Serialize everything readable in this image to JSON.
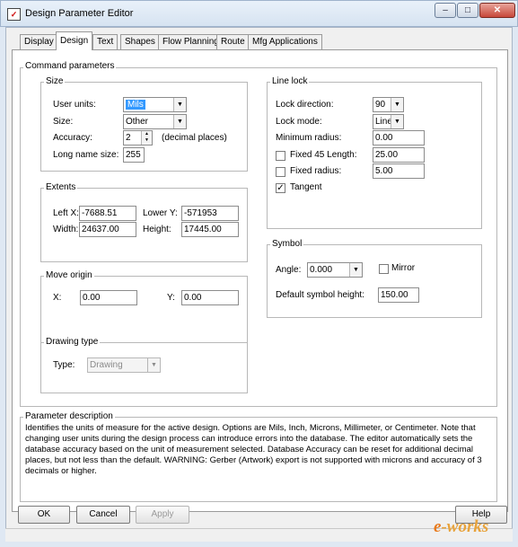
{
  "window": {
    "title": "Design Parameter Editor",
    "app_icon_glyph": "✓",
    "minimize_glyph": "–",
    "maximize_glyph": "□",
    "close_glyph": "✕"
  },
  "tabs": [
    {
      "label": "Display"
    },
    {
      "label": "Design",
      "active": true
    },
    {
      "label": "Text"
    },
    {
      "label": "Shapes"
    },
    {
      "label": "Flow Planning"
    },
    {
      "label": "Route"
    },
    {
      "label": "Mfg Applications"
    }
  ],
  "command_parameters": {
    "title": "Command parameters",
    "size": {
      "title": "Size",
      "user_units_label": "User units:",
      "user_units_value": "Mils",
      "size_label": "Size:",
      "size_value": "Other",
      "accuracy_label": "Accuracy:",
      "accuracy_value": "2",
      "accuracy_suffix": "(decimal places)",
      "long_name_label": "Long name size:",
      "long_name_value": "255"
    },
    "extents": {
      "title": "Extents",
      "left_x_label": "Left X:",
      "left_x_value": "-7688.51",
      "lower_y_label": "Lower Y:",
      "lower_y_value": "-571953",
      "width_label": "Width:",
      "width_value": "24637.00",
      "height_label": "Height:",
      "height_value": "17445.00"
    },
    "move_origin": {
      "title": "Move origin",
      "x_label": "X:",
      "x_value": "0.00",
      "y_label": "Y:",
      "y_value": "0.00"
    },
    "drawing_type": {
      "title": "Drawing type",
      "type_label": "Type:",
      "type_value": "Drawing"
    },
    "line_lock": {
      "title": "Line lock",
      "lock_direction_label": "Lock direction:",
      "lock_direction_value": "90",
      "lock_mode_label": "Lock mode:",
      "lock_mode_value": "Line",
      "min_radius_label": "Minimum radius:",
      "min_radius_value": "0.00",
      "fixed45_label": "Fixed 45 Length:",
      "fixed45_value": "25.00",
      "fixed45_checked": false,
      "fixed_radius_label": "Fixed radius:",
      "fixed_radius_value": "5.00",
      "fixed_radius_checked": false,
      "tangent_label": "Tangent",
      "tangent_checked": true,
      "check_glyph": "✓"
    },
    "symbol": {
      "title": "Symbol",
      "angle_label": "Angle:",
      "angle_value": "0.000",
      "mirror_label": "Mirror",
      "mirror_checked": false,
      "default_height_label": "Default symbol height:",
      "default_height_value": "150.00"
    }
  },
  "parameter_description": {
    "title": "Parameter description",
    "lines": [
      "Identifies the units of measure for the active design. Options are Mils, Inch, Microns, Millimeter, or Centimeter.  Note that",
      "changing user units during the design process can introduce errors into the database.  The editor automatically sets the",
      "database accuracy based on the unit of measurement selected. Database Accuracy can be reset for additional decimal",
      "places, but not less than the default. WARNING: Gerber (Artwork) export is not supported with microns and accuracy of 3",
      "decimals or higher."
    ]
  },
  "buttons": {
    "ok": "OK",
    "cancel": "Cancel",
    "apply": "Apply",
    "help": "Help"
  },
  "watermark": {
    "e": "e",
    "rest": "-works"
  },
  "colors": {
    "selection": "#3399ff",
    "titlebar": "#d6e3f1",
    "close_button": "#c7473a"
  }
}
